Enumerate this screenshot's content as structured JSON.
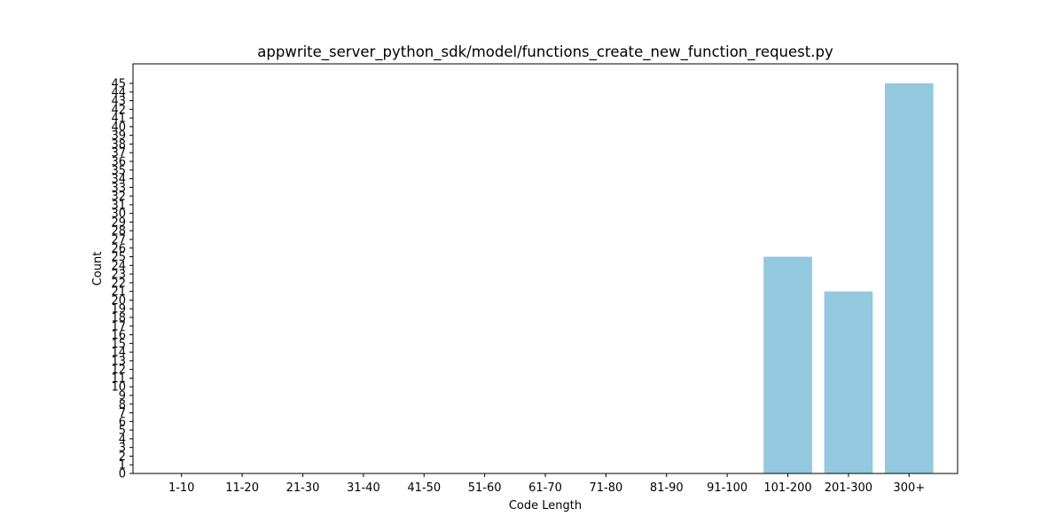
{
  "chart_data": {
    "type": "bar",
    "title": "appwrite_server_python_sdk/model/functions_create_new_function_request.py",
    "xlabel": "Code Length",
    "ylabel": "Count",
    "categories": [
      "1-10",
      "11-20",
      "21-30",
      "31-40",
      "41-50",
      "51-60",
      "61-70",
      "71-80",
      "81-90",
      "91-100",
      "101-200",
      "201-300",
      "300+"
    ],
    "values": [
      0,
      0,
      0,
      0,
      0,
      0,
      0,
      0,
      0,
      0,
      25,
      21,
      45
    ],
    "ylim": [
      0,
      47.25
    ],
    "yticks": [
      0,
      1,
      2,
      3,
      4,
      5,
      6,
      7,
      8,
      9,
      10,
      11,
      12,
      13,
      14,
      15,
      16,
      17,
      18,
      19,
      20,
      21,
      22,
      23,
      24,
      25,
      26,
      27,
      28,
      29,
      30,
      31,
      32,
      33,
      34,
      35,
      36,
      37,
      38,
      39,
      40,
      41,
      42,
      43,
      44,
      45
    ],
    "bar_color": "#92c9df",
    "grid": false,
    "legend": "none"
  }
}
